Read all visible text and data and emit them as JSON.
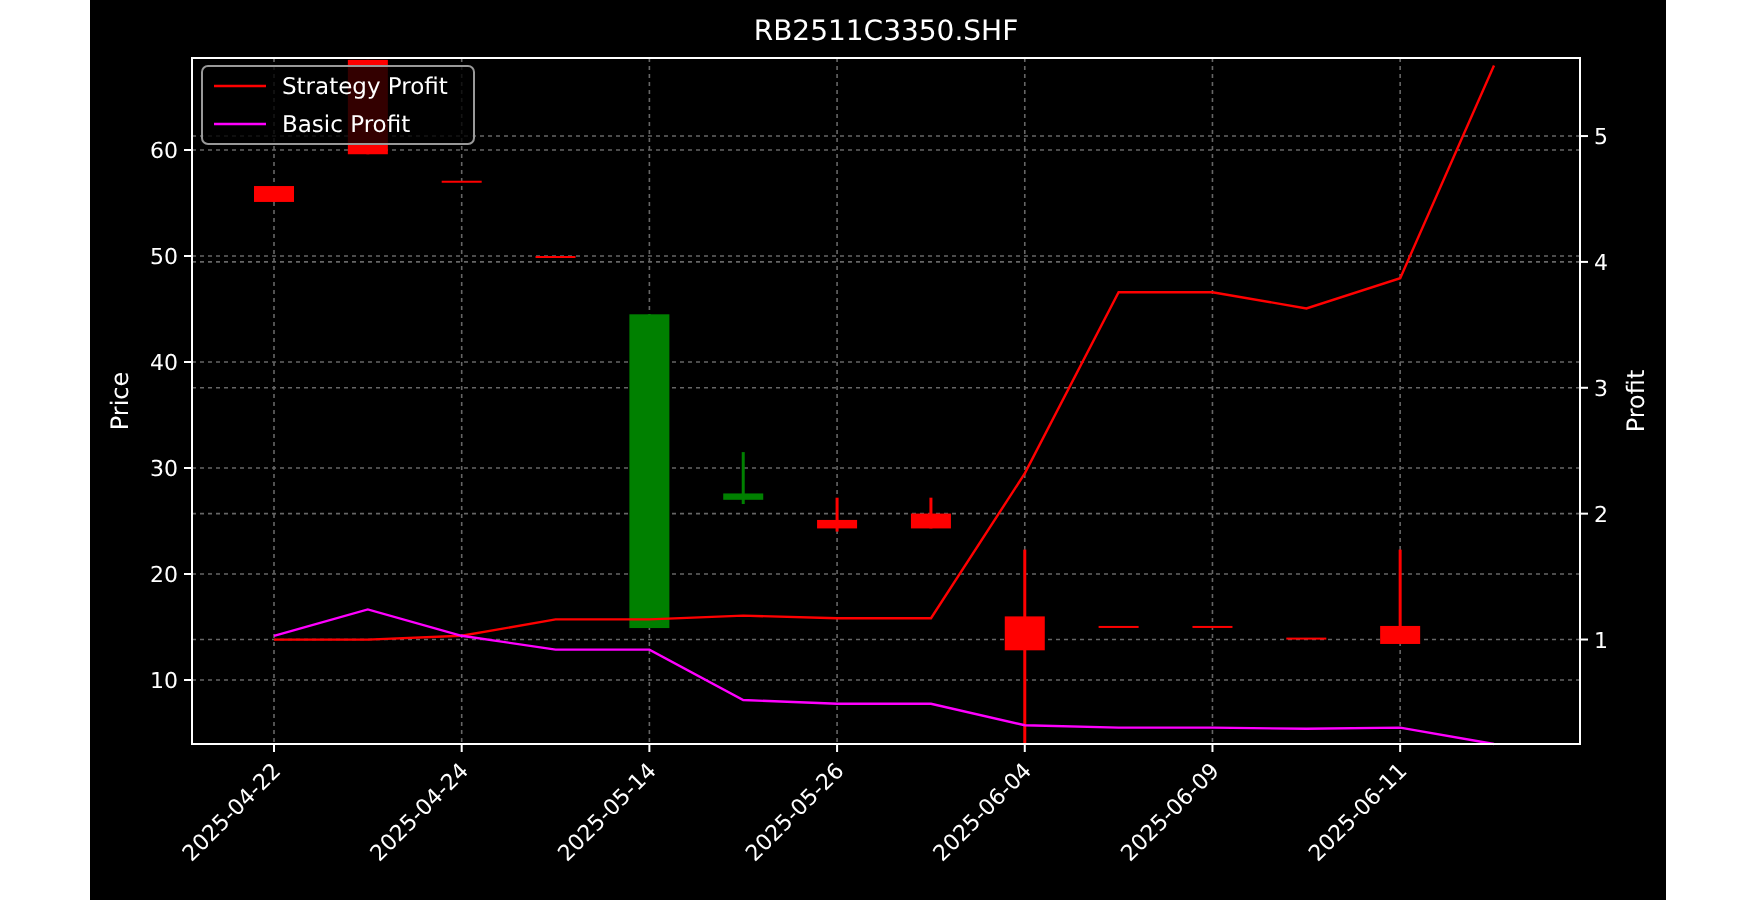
{
  "price_axis": {
    "label": "Price",
    "ticks": [
      "60",
      "50",
      "40",
      "30",
      "20",
      "10"
    ]
  },
  "chart_data": {
    "type": "line",
    "title": "RB2511C3350.SHF",
    "ylabel": "Profit",
    "grid": true,
    "legend": true,
    "categories": [
      "2025-04-22",
      null,
      "2025-04-24",
      null,
      "2025-05-14",
      null,
      "2025-05-26",
      null,
      "2025-06-04",
      null,
      "2025-06-09",
      null,
      "2025-06-11",
      null
    ],
    "ylim": [
      0.17,
      5.62
    ],
    "yticks": [
      1,
      2,
      3,
      4,
      5
    ],
    "series": [
      {
        "name": "Strategy Profit",
        "color": "#ff0000",
        "values": [
          1.0,
          1.0,
          1.03,
          1.16,
          1.16,
          1.19,
          1.17,
          1.17,
          2.32,
          3.76,
          3.76,
          3.63,
          3.87,
          5.56
        ]
      },
      {
        "name": "Basic Profit",
        "color": "#ff00ff",
        "values": [
          1.03,
          1.24,
          1.03,
          0.92,
          0.92,
          0.52,
          0.49,
          0.49,
          0.32,
          0.3,
          0.3,
          0.29,
          0.3,
          0.17
        ]
      }
    ]
  }
}
